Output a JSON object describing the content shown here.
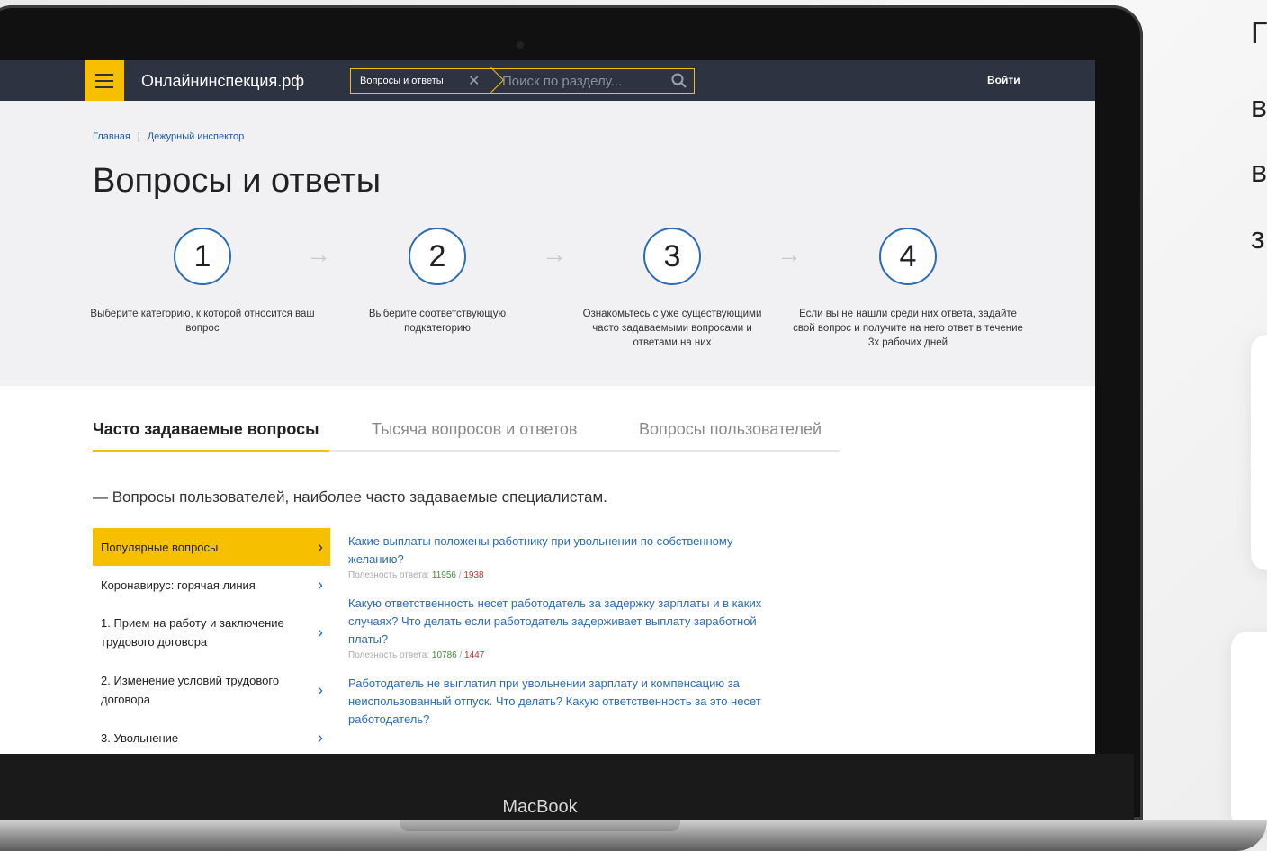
{
  "side": {
    "letters": [
      "Г",
      "в",
      "в",
      "з"
    ]
  },
  "laptop": {
    "brand": "MacBook"
  },
  "header": {
    "site_name": "Онлайнинспекция.рф",
    "search_chip": "Вопросы и ответы",
    "search_placeholder": "Поиск по разделу...",
    "login": "Войти"
  },
  "breadcrumb": {
    "home": "Главная",
    "current": "Дежурный инспектор"
  },
  "page_title": "Вопросы и ответы",
  "steps": [
    {
      "num": "1",
      "text": "Выберите категорию, к которой относится ваш вопрос"
    },
    {
      "num": "2",
      "text": "Выберите соответствующую подкатегорию"
    },
    {
      "num": "3",
      "text": "Ознакомьтесь с уже существующими часто задаваемыми вопросами и ответами на них"
    },
    {
      "num": "4",
      "text": "Если вы не нашли среди них ответа, задайте свой вопрос и получите на него ответ в течение 3х рабочих дней"
    }
  ],
  "tabs": [
    {
      "label": "Часто задаваемые вопросы",
      "active": true
    },
    {
      "label": "Тысяча вопросов и ответов",
      "active": false
    },
    {
      "label": "Вопросы пользователей",
      "active": false
    }
  ],
  "lead": "— Вопросы пользователей, наиболее часто задаваемые специалистам.",
  "categories": [
    {
      "label": "Популярные вопросы",
      "active": true
    },
    {
      "label": "Коронавирус: горячая линия",
      "active": false
    },
    {
      "label": "1. Прием на работу и заключение трудового договора",
      "active": false
    },
    {
      "label": "2. Изменение условий трудового договора",
      "active": false
    },
    {
      "label": "3. Увольнение",
      "active": false
    }
  ],
  "usefulness_label": "Полезность ответа:",
  "questions": [
    {
      "text": "Какие выплаты положены работнику при увольнении по собственному желанию?",
      "up": "11956",
      "down": "1938"
    },
    {
      "text": "Какую ответственность несет работодатель за задержку зарплаты и в каких случаях? Что делать если работодатель задерживает выплату заработной платы?",
      "up": "10786",
      "down": "1447"
    },
    {
      "text": "Работодатель не выплатил при увольнении зарплату и компенсацию за неиспользованный отпуск. Что делать? Какую ответственность за это несет работодатель?",
      "up": "",
      "down": ""
    }
  ],
  "colors": {
    "accent": "#f6c000",
    "header_bg": "#2d3340",
    "link": "#2b6cb5"
  }
}
